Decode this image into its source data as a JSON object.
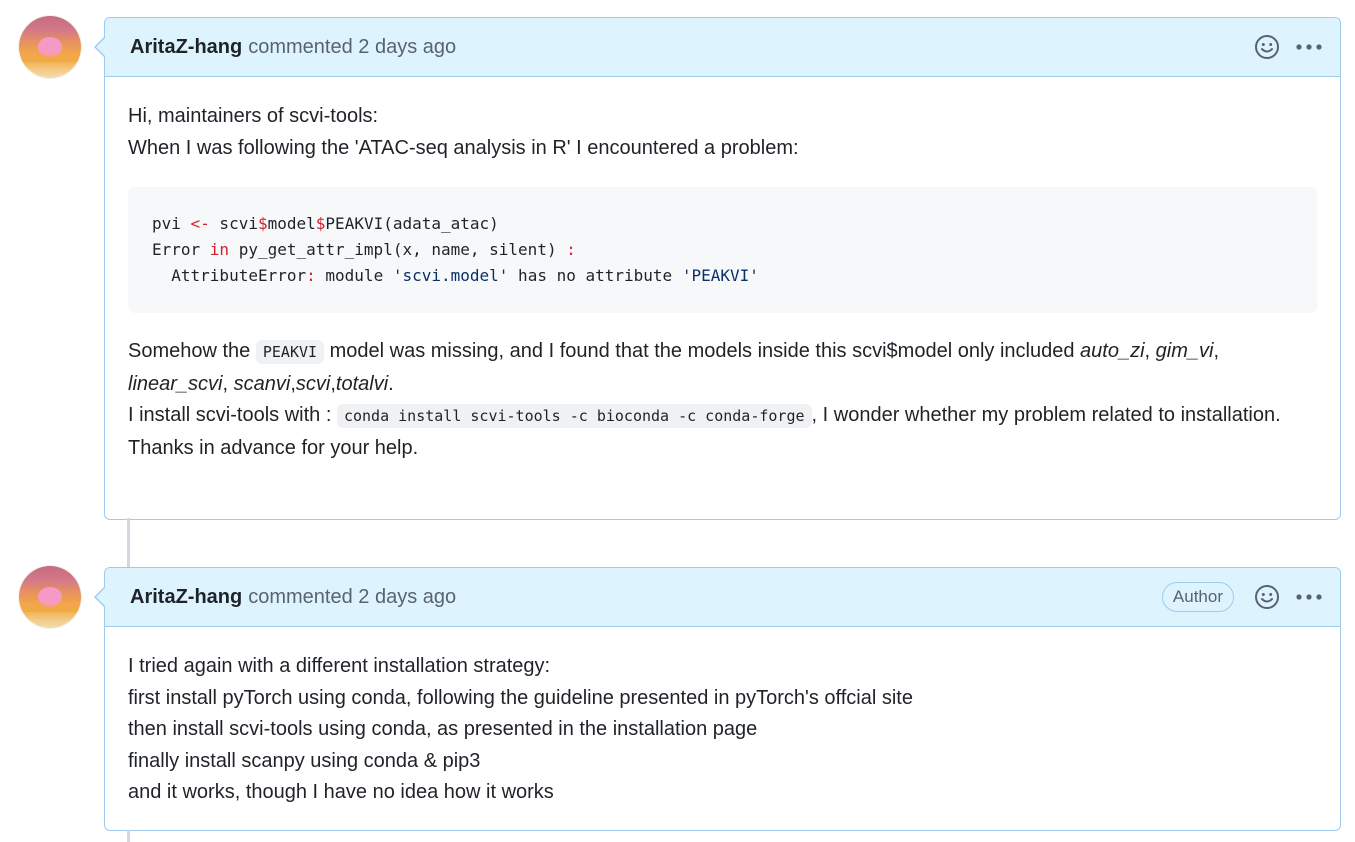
{
  "comments": [
    {
      "author": "AritaZ-hang",
      "meta": "commented 2 days ago",
      "body": {
        "intro_line1": "Hi, maintainers of scvi-tools:",
        "intro_line2": "When I was following the 'ATAC-seq analysis in R' I encountered a problem:",
        "code": {
          "l1_a": "pvi ",
          "l1_b": "<-",
          "l1_c": " scvi",
          "l1_d": "$",
          "l1_e": "model",
          "l1_f": "$",
          "l1_g": "PEAKVI(adata_atac)",
          "l2_a": "Error ",
          "l2_b": "in",
          "l2_c": " py_get_attr_impl(x, name, silent) ",
          "l2_d": ":",
          "l3_a": "  AttributeError",
          "l3_b": ":",
          "l3_c": " module ",
          "l3_d": "'scvi.model'",
          "l3_e": " has no attribute ",
          "l3_f": "'PEAKVI'"
        },
        "p2_a": "Somehow the ",
        "p2_code": "PEAKVI",
        "p2_b": " model was missing, and I found that the models inside this scvi$model only included ",
        "p2_i1": "auto_zi",
        "p2_sep1": ", ",
        "p2_i2": "gim_vi",
        "p2_sep2": ", ",
        "p2_i3": "linear_scvi",
        "p2_sep3": ", ",
        "p2_i4": "scanvi",
        "p2_sep4": ",",
        "p2_i5": "scvi",
        "p2_sep5": ",",
        "p2_i6": "totalvi",
        "p2_end": ".",
        "p3_a": "I install scvi-tools with : ",
        "p3_code": "conda install scvi-tools -c bioconda -c conda-forge",
        "p3_b": ", I wonder whether my problem related to installation.",
        "p4": "Thanks in advance for your help."
      }
    },
    {
      "author": "AritaZ-hang",
      "meta": "commented 2 days ago",
      "badge": "Author",
      "body": {
        "l1": "I tried again with a different installation strategy:",
        "l2": "first install pyTorch using conda, following the guideline presented in pyTorch's offcial site",
        "l3": "then install scvi-tools using conda, as presented in the installation page",
        "l4": "finally install scanpy using conda & pip3",
        "l5": "and it works, though I have no idea how it works"
      }
    }
  ],
  "icons": {
    "reaction": "smiley-icon",
    "menu": "kebab-horizontal-icon"
  },
  "colors": {
    "header_bg": "#ddf4ff",
    "border": "#9ecbef",
    "code_bg": "#f6f8fa",
    "keyword": "#cf222e"
  }
}
